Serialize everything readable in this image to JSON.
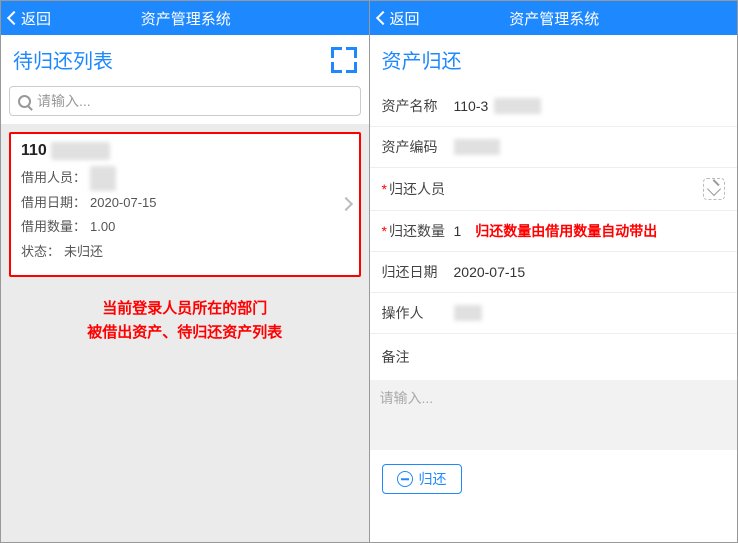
{
  "left": {
    "back_label": "返回",
    "app_title": "资产管理系统",
    "section_title": "待归还列表",
    "search_placeholder": "请输入...",
    "card": {
      "title_prefix": "110",
      "title_hidden": "-XXXXX",
      "borrower_label": "借用人员：",
      "borrower_hidden": "XXX",
      "borrow_date_label": "借用日期：",
      "borrow_date": "2020-07-15",
      "borrow_qty_label": "借用数量：",
      "borrow_qty": "1.00",
      "status_label": "状态：",
      "status": "未归还"
    },
    "annotation_line1": "当前登录人员所在的部门",
    "annotation_line2": "被借出资产、待归还资产列表"
  },
  "right": {
    "back_label": "返回",
    "app_title": "资产管理系统",
    "section_title": "资产归还",
    "asset_name_label": "资产名称",
    "asset_name_value": "110-3",
    "asset_name_hidden": "XXXXX",
    "asset_code_label": "资产编码",
    "asset_code_hidden": "XXXXX",
    "returner_label": "归还人员",
    "return_qty_label": "归还数量",
    "return_qty_value": "1",
    "return_qty_annot": "归还数量由借用数量自动带出",
    "return_date_label": "归还日期",
    "return_date_value": "2020-07-15",
    "operator_label": "操作人",
    "operator_hidden": "XXX",
    "remark_label": "备注",
    "remark_placeholder": "请输入...",
    "return_button": "归还"
  }
}
